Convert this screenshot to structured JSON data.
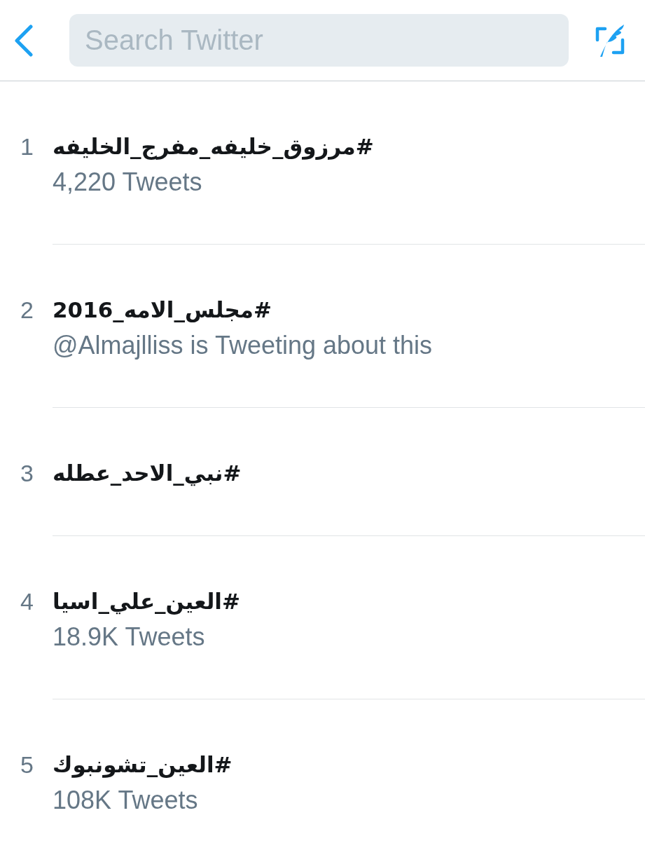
{
  "header": {
    "search": {
      "placeholder": "Search Twitter"
    }
  },
  "trends": [
    {
      "rank": "1",
      "hashtag": "#مرزوق_خليفه_مفرج_الخليفه",
      "context": "4,220 Tweets"
    },
    {
      "rank": "2",
      "hashtag": "#مجلس_الامه_2016",
      "context": "@Almajlliss is Tweeting about this"
    },
    {
      "rank": "3",
      "hashtag": "#نبي_الاحد_عطله"
    },
    {
      "rank": "4",
      "hashtag": "#العين_علي_اسيا",
      "context": "18.9K Tweets"
    },
    {
      "rank": "5",
      "hashtag": "#العين_تشونبوك",
      "context": "108K Tweets"
    }
  ]
}
